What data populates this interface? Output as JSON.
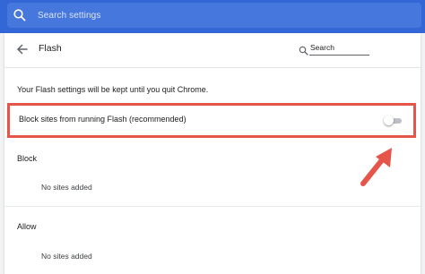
{
  "top_search": {
    "placeholder": "Search settings",
    "icon": "search-icon"
  },
  "header": {
    "title": "Flash",
    "back_icon": "arrow-back-icon",
    "search_label": "Search",
    "search_icon": "search-icon"
  },
  "info_text": "Your Flash settings will be kept until you quit Chrome.",
  "block_setting": {
    "label": "Block sites from running Flash (recommended)",
    "enabled": false
  },
  "sections": [
    {
      "title": "Block",
      "empty_text": "No sites added"
    },
    {
      "title": "Allow",
      "empty_text": "No sites added"
    }
  ],
  "colors": {
    "topbar": "#3367d6",
    "highlight_border": "#e5554a",
    "annotation_arrow": "#e5554a"
  }
}
